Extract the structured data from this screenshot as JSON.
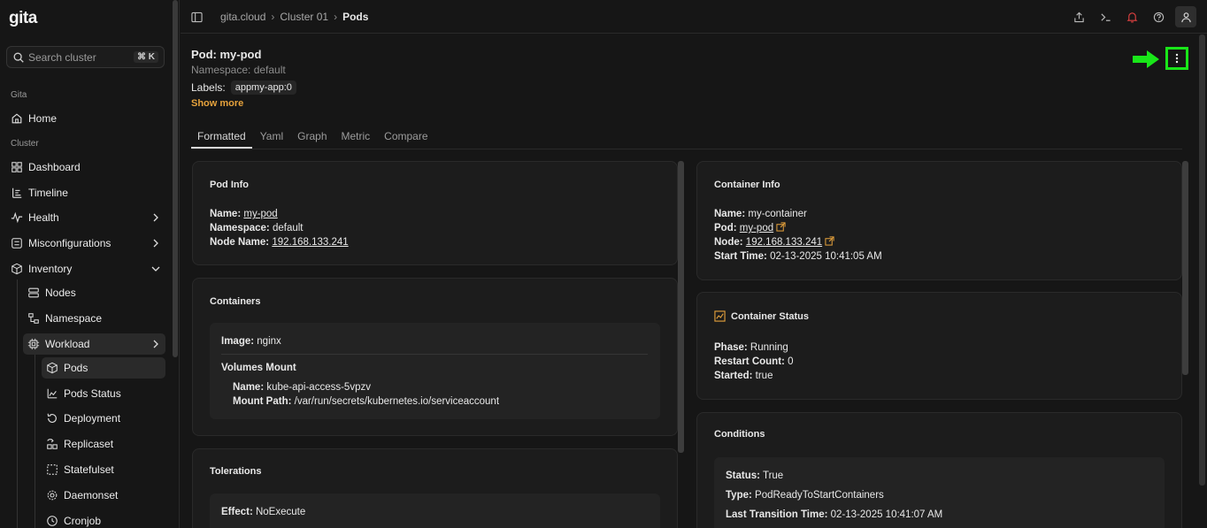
{
  "app": {
    "logo": "gita"
  },
  "search": {
    "placeholder": "Search cluster",
    "shortcut": "⌘ K"
  },
  "sidebar": {
    "section_gita": "Gita",
    "section_cluster": "Cluster",
    "items": [
      {
        "label": "Home",
        "icon": "home-icon"
      },
      {
        "label": "Dashboard",
        "icon": "grid-icon"
      },
      {
        "label": "Timeline",
        "icon": "timeline-icon"
      },
      {
        "label": "Health",
        "icon": "activity-icon"
      },
      {
        "label": "Misconfigurations",
        "icon": "sliders-icon"
      },
      {
        "label": "Inventory",
        "icon": "box-icon"
      },
      {
        "label": "Nodes",
        "icon": "server-icon"
      },
      {
        "label": "Namespace",
        "icon": "namespace-icon"
      },
      {
        "label": "Workload",
        "icon": "cpu-icon"
      },
      {
        "label": "Pods",
        "icon": "cube-icon"
      },
      {
        "label": "Pods Status",
        "icon": "chart-icon"
      },
      {
        "label": "Deployment",
        "icon": "rotate-icon"
      },
      {
        "label": "Replicaset",
        "icon": "replicaset-icon"
      },
      {
        "label": "Statefulset",
        "icon": "dashed-square-icon"
      },
      {
        "label": "Daemonset",
        "icon": "gear-icon"
      },
      {
        "label": "Cronjob",
        "icon": "clock-icon"
      }
    ]
  },
  "breadcrumb": {
    "items": [
      "gita.cloud",
      "Cluster 01",
      "Pods"
    ]
  },
  "pod": {
    "title": "Pod: my-pod",
    "namespace": "Namespace: default",
    "labels_label": "Labels:",
    "label_chip": "appmy-app:0",
    "show_more": "Show more"
  },
  "tabs": [
    "Formatted",
    "Yaml",
    "Graph",
    "Metric",
    "Compare"
  ],
  "pod_info": {
    "title": "Pod Info",
    "name_k": "Name:",
    "name_v": "my-pod",
    "ns_k": "Namespace:",
    "ns_v": "default",
    "node_k": "Node Name:",
    "node_v": "192.168.133.241"
  },
  "containers": {
    "title": "Containers",
    "image_k": "Image:",
    "image_v": "nginx",
    "volumes_title": "Volumes Mount",
    "vname_k": "Name:",
    "vname_v": "kube-api-access-5vpzv",
    "mpath_k": "Mount Path:",
    "mpath_v": "/var/run/secrets/kubernetes.io/serviceaccount"
  },
  "tolerations": {
    "title": "Tolerations",
    "effect_k": "Effect:",
    "effect_v": "NoExecute"
  },
  "container_info": {
    "title": "Container Info",
    "name_k": "Name:",
    "name_v": "my-container",
    "pod_k": "Pod:",
    "pod_v": "my-pod",
    "node_k": "Node:",
    "node_v": "192.168.133.241",
    "start_k": "Start Time:",
    "start_v": "02-13-2025 10:41:05 AM"
  },
  "container_status": {
    "title": "Container Status",
    "phase_k": "Phase:",
    "phase_v": "Running",
    "restart_k": "Restart Count:",
    "restart_v": "0",
    "started_k": "Started:",
    "started_v": "true"
  },
  "conditions": {
    "title": "Conditions",
    "status_k": "Status:",
    "status_v": "True",
    "type_k": "Type:",
    "type_v": "PodReadyToStartContainers",
    "ltt_k": "Last Transition Time:",
    "ltt_v": "02-13-2025 10:41:07 AM"
  },
  "colors": {
    "accent": "#e6a23c",
    "highlight_box": "#19e619",
    "alert": "#e04040"
  }
}
